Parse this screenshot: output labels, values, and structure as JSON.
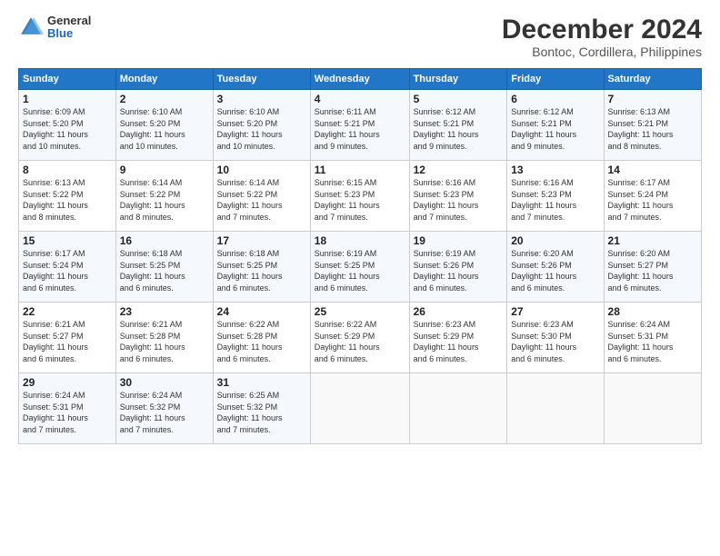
{
  "header": {
    "logo": {
      "general": "General",
      "blue": "Blue"
    },
    "title": "December 2024",
    "location": "Bontoc, Cordillera, Philippines"
  },
  "calendar": {
    "headers": [
      "Sunday",
      "Monday",
      "Tuesday",
      "Wednesday",
      "Thursday",
      "Friday",
      "Saturday"
    ],
    "weeks": [
      [
        {
          "day": "1",
          "info": "Sunrise: 6:09 AM\nSunset: 5:20 PM\nDaylight: 11 hours\nand 10 minutes."
        },
        {
          "day": "2",
          "info": "Sunrise: 6:10 AM\nSunset: 5:20 PM\nDaylight: 11 hours\nand 10 minutes."
        },
        {
          "day": "3",
          "info": "Sunrise: 6:10 AM\nSunset: 5:20 PM\nDaylight: 11 hours\nand 10 minutes."
        },
        {
          "day": "4",
          "info": "Sunrise: 6:11 AM\nSunset: 5:21 PM\nDaylight: 11 hours\nand 9 minutes."
        },
        {
          "day": "5",
          "info": "Sunrise: 6:12 AM\nSunset: 5:21 PM\nDaylight: 11 hours\nand 9 minutes."
        },
        {
          "day": "6",
          "info": "Sunrise: 6:12 AM\nSunset: 5:21 PM\nDaylight: 11 hours\nand 9 minutes."
        },
        {
          "day": "7",
          "info": "Sunrise: 6:13 AM\nSunset: 5:21 PM\nDaylight: 11 hours\nand 8 minutes."
        }
      ],
      [
        {
          "day": "8",
          "info": "Sunrise: 6:13 AM\nSunset: 5:22 PM\nDaylight: 11 hours\nand 8 minutes."
        },
        {
          "day": "9",
          "info": "Sunrise: 6:14 AM\nSunset: 5:22 PM\nDaylight: 11 hours\nand 8 minutes."
        },
        {
          "day": "10",
          "info": "Sunrise: 6:14 AM\nSunset: 5:22 PM\nDaylight: 11 hours\nand 7 minutes."
        },
        {
          "day": "11",
          "info": "Sunrise: 6:15 AM\nSunset: 5:23 PM\nDaylight: 11 hours\nand 7 minutes."
        },
        {
          "day": "12",
          "info": "Sunrise: 6:16 AM\nSunset: 5:23 PM\nDaylight: 11 hours\nand 7 minutes."
        },
        {
          "day": "13",
          "info": "Sunrise: 6:16 AM\nSunset: 5:23 PM\nDaylight: 11 hours\nand 7 minutes."
        },
        {
          "day": "14",
          "info": "Sunrise: 6:17 AM\nSunset: 5:24 PM\nDaylight: 11 hours\nand 7 minutes."
        }
      ],
      [
        {
          "day": "15",
          "info": "Sunrise: 6:17 AM\nSunset: 5:24 PM\nDaylight: 11 hours\nand 6 minutes."
        },
        {
          "day": "16",
          "info": "Sunrise: 6:18 AM\nSunset: 5:25 PM\nDaylight: 11 hours\nand 6 minutes."
        },
        {
          "day": "17",
          "info": "Sunrise: 6:18 AM\nSunset: 5:25 PM\nDaylight: 11 hours\nand 6 minutes."
        },
        {
          "day": "18",
          "info": "Sunrise: 6:19 AM\nSunset: 5:25 PM\nDaylight: 11 hours\nand 6 minutes."
        },
        {
          "day": "19",
          "info": "Sunrise: 6:19 AM\nSunset: 5:26 PM\nDaylight: 11 hours\nand 6 minutes."
        },
        {
          "day": "20",
          "info": "Sunrise: 6:20 AM\nSunset: 5:26 PM\nDaylight: 11 hours\nand 6 minutes."
        },
        {
          "day": "21",
          "info": "Sunrise: 6:20 AM\nSunset: 5:27 PM\nDaylight: 11 hours\nand 6 minutes."
        }
      ],
      [
        {
          "day": "22",
          "info": "Sunrise: 6:21 AM\nSunset: 5:27 PM\nDaylight: 11 hours\nand 6 minutes."
        },
        {
          "day": "23",
          "info": "Sunrise: 6:21 AM\nSunset: 5:28 PM\nDaylight: 11 hours\nand 6 minutes."
        },
        {
          "day": "24",
          "info": "Sunrise: 6:22 AM\nSunset: 5:28 PM\nDaylight: 11 hours\nand 6 minutes."
        },
        {
          "day": "25",
          "info": "Sunrise: 6:22 AM\nSunset: 5:29 PM\nDaylight: 11 hours\nand 6 minutes."
        },
        {
          "day": "26",
          "info": "Sunrise: 6:23 AM\nSunset: 5:29 PM\nDaylight: 11 hours\nand 6 minutes."
        },
        {
          "day": "27",
          "info": "Sunrise: 6:23 AM\nSunset: 5:30 PM\nDaylight: 11 hours\nand 6 minutes."
        },
        {
          "day": "28",
          "info": "Sunrise: 6:24 AM\nSunset: 5:31 PM\nDaylight: 11 hours\nand 6 minutes."
        }
      ],
      [
        {
          "day": "29",
          "info": "Sunrise: 6:24 AM\nSunset: 5:31 PM\nDaylight: 11 hours\nand 7 minutes."
        },
        {
          "day": "30",
          "info": "Sunrise: 6:24 AM\nSunset: 5:32 PM\nDaylight: 11 hours\nand 7 minutes."
        },
        {
          "day": "31",
          "info": "Sunrise: 6:25 AM\nSunset: 5:32 PM\nDaylight: 11 hours\nand 7 minutes."
        },
        {
          "day": "",
          "info": ""
        },
        {
          "day": "",
          "info": ""
        },
        {
          "day": "",
          "info": ""
        },
        {
          "day": "",
          "info": ""
        }
      ]
    ]
  }
}
